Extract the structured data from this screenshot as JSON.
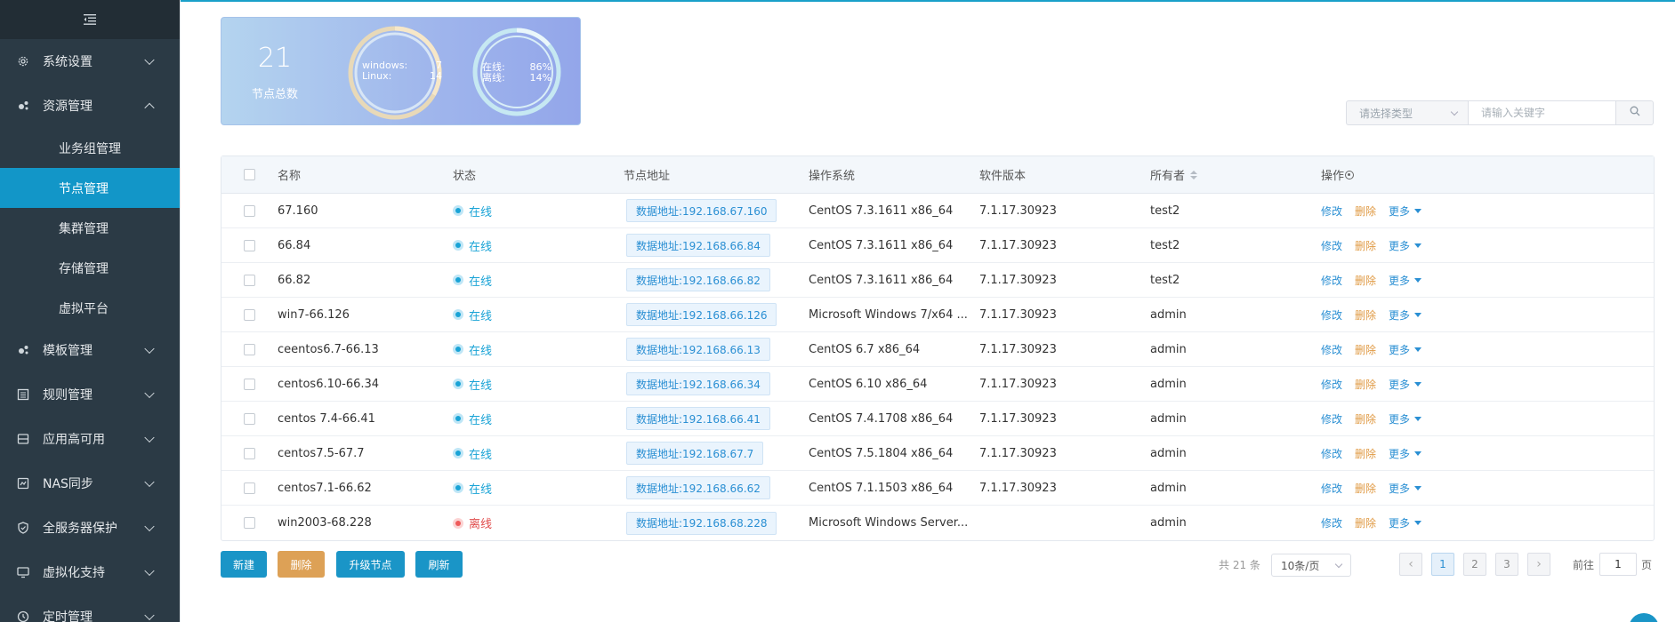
{
  "sidebar": {
    "toggle_icon": "menu-fold-icon",
    "menus": [
      {
        "label": "系统设置",
        "icon": "gear-icon",
        "expanded": false
      },
      {
        "label": "资源管理",
        "icon": "resource-icon",
        "expanded": true,
        "children": [
          {
            "label": "业务组管理",
            "active": false
          },
          {
            "label": "节点管理",
            "active": true
          },
          {
            "label": "集群管理",
            "active": false
          },
          {
            "label": "存储管理",
            "active": false
          },
          {
            "label": "虚拟平台",
            "active": false
          }
        ]
      },
      {
        "label": "模板管理",
        "icon": "template-icon",
        "expanded": false
      },
      {
        "label": "规则管理",
        "icon": "rules-icon",
        "expanded": false
      },
      {
        "label": "应用高可用",
        "icon": "ha-icon",
        "expanded": false
      },
      {
        "label": "NAS同步",
        "icon": "nas-icon",
        "expanded": false
      },
      {
        "label": "全服务器保护",
        "icon": "shield-icon",
        "expanded": false
      },
      {
        "label": "虚拟化支持",
        "icon": "monitor-icon",
        "expanded": false
      },
      {
        "label": "定时管理",
        "icon": "clock-icon",
        "expanded": false
      }
    ]
  },
  "stats": {
    "total": "21",
    "total_label": "节点总数",
    "os_windows_label": "windows:",
    "os_windows_value": "7",
    "os_linux_label": "Linux:",
    "os_linux_value": "14",
    "online_label": "在线:",
    "online_value": "86%",
    "offline_label": "离线:",
    "offline_value": "14%"
  },
  "search": {
    "type_placeholder": "请选择类型",
    "keyword_placeholder": "请输入关键字"
  },
  "table": {
    "headers": {
      "name": "名称",
      "status": "状态",
      "address": "节点地址",
      "os": "操作系统",
      "version": "软件版本",
      "owner": "所有者",
      "ops": "操作"
    },
    "op_labels": {
      "edit": "修改",
      "delete": "删除",
      "more": "更多"
    },
    "rows": [
      {
        "name": "67.160",
        "status": "在线",
        "online": true,
        "address": "数据地址:192.168.67.160",
        "os": "CentOS 7.3.1611 x86_64",
        "version": "7.1.17.30923",
        "owner": "test2"
      },
      {
        "name": "66.84",
        "status": "在线",
        "online": true,
        "address": "数据地址:192.168.66.84",
        "os": "CentOS 7.3.1611 x86_64",
        "version": "7.1.17.30923",
        "owner": "test2"
      },
      {
        "name": "66.82",
        "status": "在线",
        "online": true,
        "address": "数据地址:192.168.66.82",
        "os": "CentOS 7.3.1611 x86_64",
        "version": "7.1.17.30923",
        "owner": "test2"
      },
      {
        "name": "win7-66.126",
        "status": "在线",
        "online": true,
        "address": "数据地址:192.168.66.126",
        "os": "Microsoft Windows 7/x64 ...",
        "version": "7.1.17.30923",
        "owner": "admin"
      },
      {
        "name": "ceentos6.7-66.13",
        "status": "在线",
        "online": true,
        "address": "数据地址:192.168.66.13",
        "os": "CentOS 6.7 x86_64",
        "version": "7.1.17.30923",
        "owner": "admin"
      },
      {
        "name": "centos6.10-66.34",
        "status": "在线",
        "online": true,
        "address": "数据地址:192.168.66.34",
        "os": "CentOS 6.10 x86_64",
        "version": "7.1.17.30923",
        "owner": "admin"
      },
      {
        "name": "centos 7.4-66.41",
        "status": "在线",
        "online": true,
        "address": "数据地址:192.168.66.41",
        "os": "CentOS 7.4.1708 x86_64",
        "version": "7.1.17.30923",
        "owner": "admin"
      },
      {
        "name": "centos7.5-67.7",
        "status": "在线",
        "online": true,
        "address": "数据地址:192.168.67.7",
        "os": "CentOS 7.5.1804 x86_64",
        "version": "7.1.17.30923",
        "owner": "admin"
      },
      {
        "name": "centos7.1-66.62",
        "status": "在线",
        "online": true,
        "address": "数据地址:192.168.66.62",
        "os": "CentOS 7.1.1503 x86_64",
        "version": "7.1.17.30923",
        "owner": "admin"
      },
      {
        "name": "win2003-68.228",
        "status": "离线",
        "online": false,
        "address": "数据地址:192.168.68.228",
        "os": "Microsoft Windows Server...",
        "version": "",
        "owner": "admin"
      }
    ]
  },
  "actions": {
    "new": "新建",
    "delete": "删除",
    "upgrade": "升级节点",
    "refresh": "刷新"
  },
  "pagination": {
    "total_text": "共 21 条",
    "page_size": "10条/页",
    "pages": [
      "1",
      "2",
      "3"
    ],
    "current": "1",
    "goto_label": "前往",
    "goto_value": "1",
    "goto_unit": "页"
  },
  "colors": {
    "sidebar_bg": "#2b3a45",
    "active": "#1296c8",
    "online": "#19a3d6",
    "offline": "#e14d4d",
    "delete": "#dda156"
  }
}
